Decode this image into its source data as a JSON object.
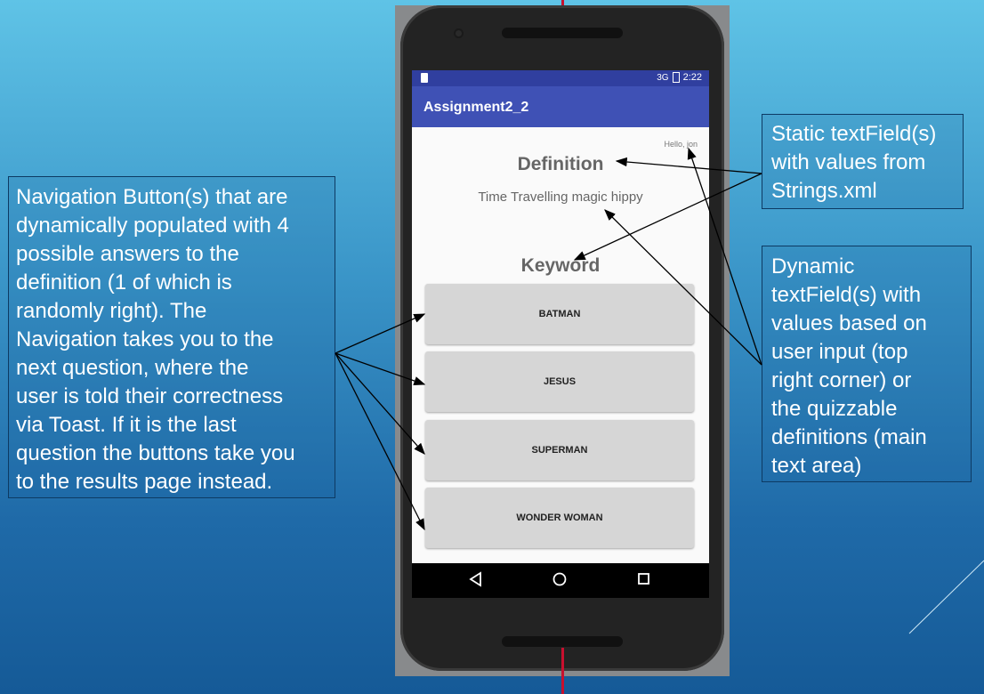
{
  "callouts": {
    "left_lines": [
      "Navigation Button(s) that are",
      "dynamically populated with 4",
      "possible answers to the",
      "definition (1 of which is",
      "randomly right). The",
      "Navigation takes you to the",
      "next question, where the",
      "user is told their correctness",
      "via Toast. If it is the last",
      "question the buttons take you",
      "to the results page instead."
    ],
    "static_lines": [
      "Static textField(s)",
      "with values from",
      "Strings.xml"
    ],
    "dynamic_lines": [
      "Dynamic",
      "textField(s) with",
      "values based on",
      "user input (top",
      "right corner) or",
      "the quizzable",
      "definitions (main",
      "text area)"
    ]
  },
  "phone": {
    "status_time": "2:22",
    "status_signal": "3G",
    "app_title": "Assignment2_2",
    "hello_text": "Hello, jon",
    "definition_label": "Definition",
    "definition_value": "Time Travelling magic hippy",
    "keyword_label": "Keyword",
    "answers": [
      "BATMAN",
      "JESUS",
      "SUPERMAN",
      "WONDER WOMAN"
    ],
    "nav": {
      "back_icon": "back-triangle-icon",
      "home_icon": "home-circle-icon",
      "recents_icon": "recents-square-icon"
    }
  },
  "colors": {
    "status_bar": "#303f9f",
    "app_bar": "#3f51b5",
    "button_bg": "#d6d6d6",
    "arrow_accent": "#c8102e"
  }
}
